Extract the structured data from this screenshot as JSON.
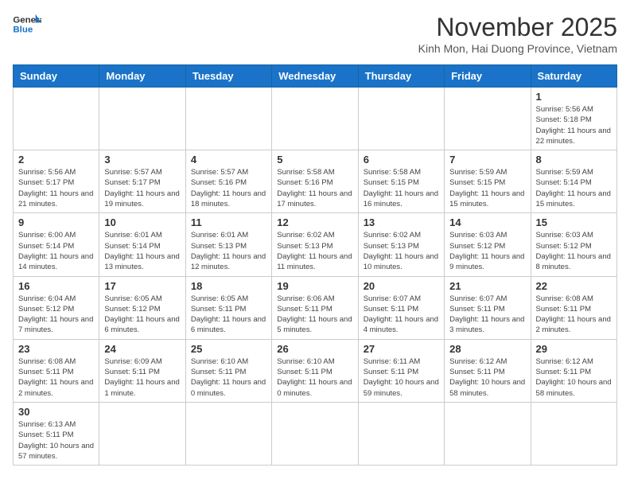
{
  "logo": {
    "line1": "General",
    "line2": "Blue"
  },
  "title": "November 2025",
  "location": "Kinh Mon, Hai Duong Province, Vietnam",
  "weekdays": [
    "Sunday",
    "Monday",
    "Tuesday",
    "Wednesday",
    "Thursday",
    "Friday",
    "Saturday"
  ],
  "days": [
    {
      "date": null,
      "info": ""
    },
    {
      "date": null,
      "info": ""
    },
    {
      "date": null,
      "info": ""
    },
    {
      "date": null,
      "info": ""
    },
    {
      "date": null,
      "info": ""
    },
    {
      "date": null,
      "info": ""
    },
    {
      "date": "1",
      "info": "Sunrise: 5:56 AM\nSunset: 5:18 PM\nDaylight: 11 hours\nand 22 minutes."
    },
    {
      "date": "2",
      "info": "Sunrise: 5:56 AM\nSunset: 5:17 PM\nDaylight: 11 hours\nand 21 minutes."
    },
    {
      "date": "3",
      "info": "Sunrise: 5:57 AM\nSunset: 5:17 PM\nDaylight: 11 hours\nand 19 minutes."
    },
    {
      "date": "4",
      "info": "Sunrise: 5:57 AM\nSunset: 5:16 PM\nDaylight: 11 hours\nand 18 minutes."
    },
    {
      "date": "5",
      "info": "Sunrise: 5:58 AM\nSunset: 5:16 PM\nDaylight: 11 hours\nand 17 minutes."
    },
    {
      "date": "6",
      "info": "Sunrise: 5:58 AM\nSunset: 5:15 PM\nDaylight: 11 hours\nand 16 minutes."
    },
    {
      "date": "7",
      "info": "Sunrise: 5:59 AM\nSunset: 5:15 PM\nDaylight: 11 hours\nand 15 minutes."
    },
    {
      "date": "8",
      "info": "Sunrise: 5:59 AM\nSunset: 5:14 PM\nDaylight: 11 hours\nand 15 minutes."
    },
    {
      "date": "9",
      "info": "Sunrise: 6:00 AM\nSunset: 5:14 PM\nDaylight: 11 hours\nand 14 minutes."
    },
    {
      "date": "10",
      "info": "Sunrise: 6:01 AM\nSunset: 5:14 PM\nDaylight: 11 hours\nand 13 minutes."
    },
    {
      "date": "11",
      "info": "Sunrise: 6:01 AM\nSunset: 5:13 PM\nDaylight: 11 hours\nand 12 minutes."
    },
    {
      "date": "12",
      "info": "Sunrise: 6:02 AM\nSunset: 5:13 PM\nDaylight: 11 hours\nand 11 minutes."
    },
    {
      "date": "13",
      "info": "Sunrise: 6:02 AM\nSunset: 5:13 PM\nDaylight: 11 hours\nand 10 minutes."
    },
    {
      "date": "14",
      "info": "Sunrise: 6:03 AM\nSunset: 5:12 PM\nDaylight: 11 hours\nand 9 minutes."
    },
    {
      "date": "15",
      "info": "Sunrise: 6:03 AM\nSunset: 5:12 PM\nDaylight: 11 hours\nand 8 minutes."
    },
    {
      "date": "16",
      "info": "Sunrise: 6:04 AM\nSunset: 5:12 PM\nDaylight: 11 hours\nand 7 minutes."
    },
    {
      "date": "17",
      "info": "Sunrise: 6:05 AM\nSunset: 5:12 PM\nDaylight: 11 hours\nand 6 minutes."
    },
    {
      "date": "18",
      "info": "Sunrise: 6:05 AM\nSunset: 5:11 PM\nDaylight: 11 hours\nand 6 minutes."
    },
    {
      "date": "19",
      "info": "Sunrise: 6:06 AM\nSunset: 5:11 PM\nDaylight: 11 hours\nand 5 minutes."
    },
    {
      "date": "20",
      "info": "Sunrise: 6:07 AM\nSunset: 5:11 PM\nDaylight: 11 hours\nand 4 minutes."
    },
    {
      "date": "21",
      "info": "Sunrise: 6:07 AM\nSunset: 5:11 PM\nDaylight: 11 hours\nand 3 minutes."
    },
    {
      "date": "22",
      "info": "Sunrise: 6:08 AM\nSunset: 5:11 PM\nDaylight: 11 hours\nand 2 minutes."
    },
    {
      "date": "23",
      "info": "Sunrise: 6:08 AM\nSunset: 5:11 PM\nDaylight: 11 hours\nand 2 minutes."
    },
    {
      "date": "24",
      "info": "Sunrise: 6:09 AM\nSunset: 5:11 PM\nDaylight: 11 hours\nand 1 minute."
    },
    {
      "date": "25",
      "info": "Sunrise: 6:10 AM\nSunset: 5:11 PM\nDaylight: 11 hours\nand 0 minutes."
    },
    {
      "date": "26",
      "info": "Sunrise: 6:10 AM\nSunset: 5:11 PM\nDaylight: 11 hours\nand 0 minutes."
    },
    {
      "date": "27",
      "info": "Sunrise: 6:11 AM\nSunset: 5:11 PM\nDaylight: 10 hours\nand 59 minutes."
    },
    {
      "date": "28",
      "info": "Sunrise: 6:12 AM\nSunset: 5:11 PM\nDaylight: 10 hours\nand 58 minutes."
    },
    {
      "date": "29",
      "info": "Sunrise: 6:12 AM\nSunset: 5:11 PM\nDaylight: 10 hours\nand 58 minutes."
    },
    {
      "date": "30",
      "info": "Sunrise: 6:13 AM\nSunset: 5:11 PM\nDaylight: 10 hours\nand 57 minutes."
    },
    {
      "date": null,
      "info": ""
    },
    {
      "date": null,
      "info": ""
    },
    {
      "date": null,
      "info": ""
    },
    {
      "date": null,
      "info": ""
    },
    {
      "date": null,
      "info": ""
    },
    {
      "date": null,
      "info": ""
    }
  ]
}
